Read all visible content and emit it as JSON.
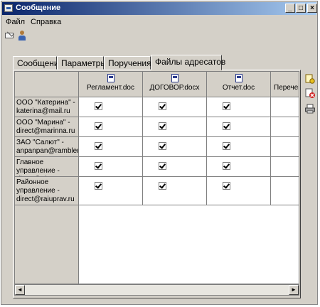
{
  "window": {
    "title": "Сообщение"
  },
  "title_buttons": {
    "minimize": "_",
    "maximize": "□",
    "close": "×"
  },
  "menu": [
    "Файл",
    "Справка"
  ],
  "toolbar_icons": [
    "envelope-icon",
    "person-icon"
  ],
  "tabs": [
    {
      "label": "Сообщение",
      "active": false
    },
    {
      "label": "Параметры",
      "active": false
    },
    {
      "label": "Поручения",
      "active": false
    },
    {
      "label": "Файлы адресатов",
      "active": true
    }
  ],
  "files": [
    "Регламент.doc",
    "ДОГОВОР.docx",
    "Отчет.doc",
    "Перечень"
  ],
  "recipients": [
    {
      "name": "ООО \"Катерина\" - katerina@mail.ru",
      "checks": [
        true,
        true,
        true,
        false
      ]
    },
    {
      "name": "ООО \"Марина\" - direct@marinna.ru",
      "checks": [
        true,
        true,
        true,
        false
      ]
    },
    {
      "name": "ЗАО \"Салют\" - anpanpan@rambler.ru",
      "checks": [
        true,
        true,
        true,
        false
      ]
    },
    {
      "name": "Главное управление - direct@glavuprav.ru",
      "checks": [
        true,
        true,
        true,
        false
      ]
    },
    {
      "name": "Районное управление - direct@raiuprav.ru",
      "checks": [
        true,
        true,
        true,
        false
      ]
    }
  ],
  "side_icons": [
    "add-file-icon",
    "delete-file-icon",
    "print-icon"
  ],
  "scroll": {
    "left": "◄",
    "right": "►"
  },
  "colors": {
    "titlebar": "#0a246a",
    "face": "#d4d0c8"
  }
}
